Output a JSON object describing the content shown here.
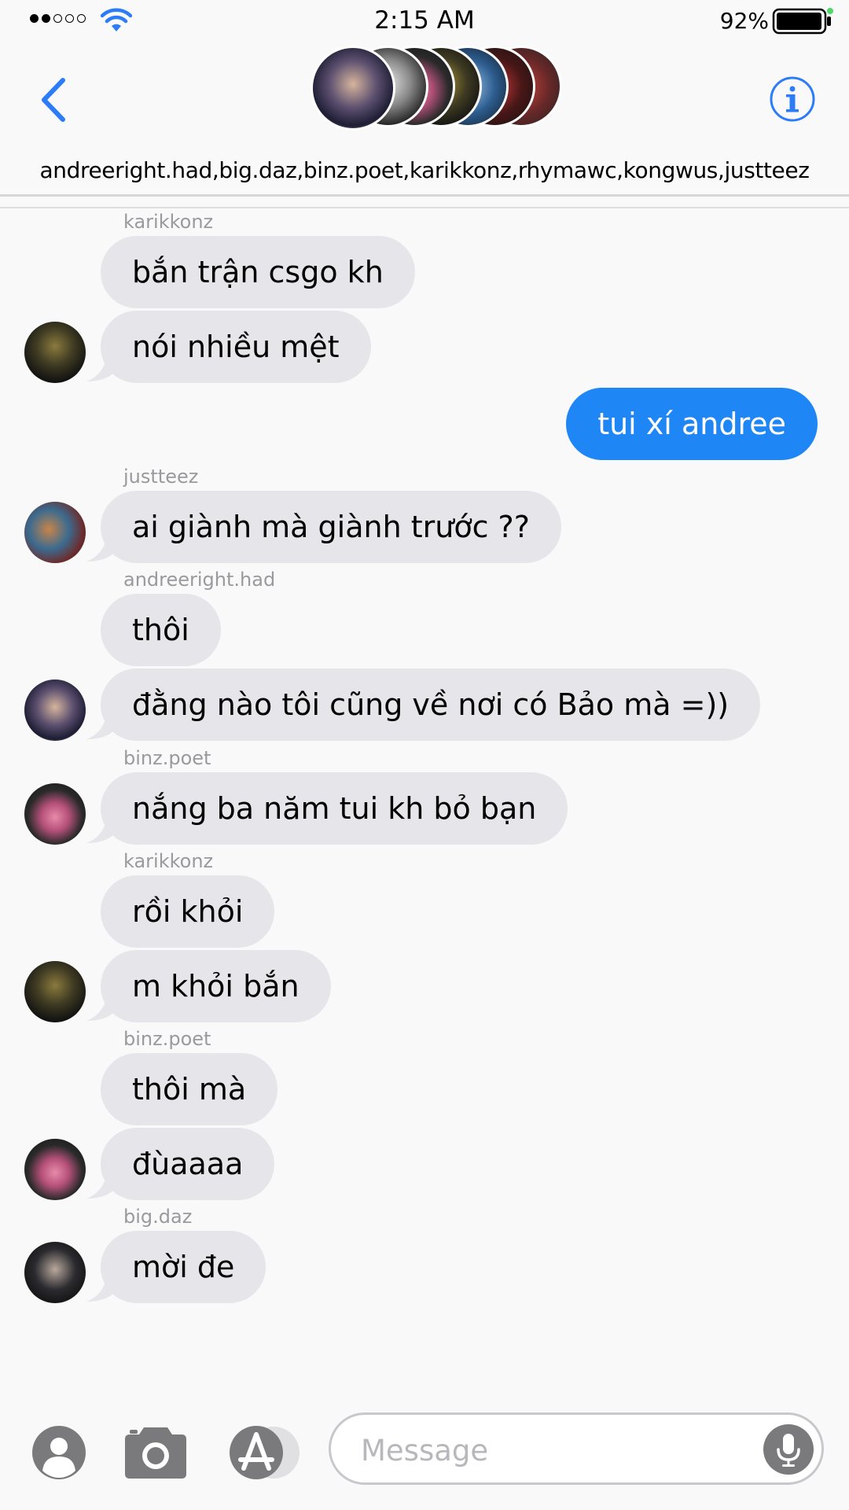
{
  "status_bar": {
    "time": "2:15 AM",
    "battery_percent": "92%",
    "signal_bars_filled": 2,
    "signal_bars_total": 5
  },
  "header": {
    "members": "andreeright.had,big.daz,binz.poet,karikkonz,rhymawc,kongwus,justteez",
    "back_icon": "chevron-left-icon",
    "info_icon": "info-icon",
    "accent_color": "#1f87f5"
  },
  "messages": [
    {
      "sender": "karikkonz",
      "text": "bắn trận csgo kh",
      "direction": "incoming"
    },
    {
      "text": "nói nhiều mệt",
      "direction": "incoming"
    },
    {
      "text": "tui xí andree",
      "direction": "outgoing"
    },
    {
      "sender": "justteez",
      "text": "ai giành mà giành trước ??",
      "direction": "incoming"
    },
    {
      "sender": "andreeright.had",
      "text": "thôi",
      "direction": "incoming"
    },
    {
      "text": "đằng nào tôi cũng về nơi có Bảo mà =))",
      "direction": "incoming"
    },
    {
      "sender": "binz.poet",
      "text": "nắng ba năm tui kh bỏ bạn",
      "direction": "incoming"
    },
    {
      "sender": "karikkonz",
      "text": "rồi khỏi",
      "direction": "incoming"
    },
    {
      "text": "m khỏi bắn",
      "direction": "incoming"
    },
    {
      "sender": "binz.poet",
      "text": "thôi mà",
      "direction": "incoming"
    },
    {
      "text": "đùaaaa",
      "direction": "incoming"
    },
    {
      "sender": "big.daz",
      "text": "mời đe",
      "direction": "incoming"
    }
  ],
  "input_bar": {
    "placeholder": "Message",
    "icons": [
      "memoji-icon",
      "camera-icon",
      "app-store-icon",
      "microphone-icon"
    ]
  },
  "colors": {
    "incoming_bubble": "#e5e5ea",
    "outgoing_bubble": "#1f87f5",
    "sender_name": "#9a9a9e"
  }
}
